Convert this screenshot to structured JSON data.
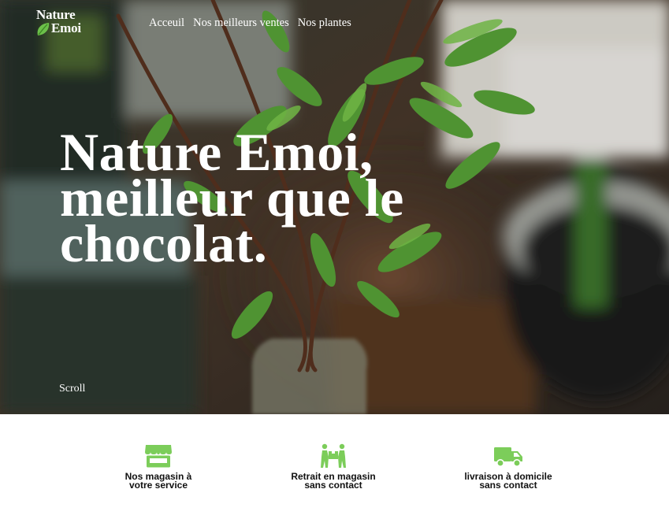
{
  "brand": {
    "name_line1": "Nature",
    "name_line2": "Emoi",
    "leaf_icon": "leaf-icon",
    "accent_color": "#6cc04a"
  },
  "nav": {
    "items": [
      {
        "label": "Acceuil"
      },
      {
        "label": "Nos meilleurs ventes"
      },
      {
        "label": "Nos plantes"
      }
    ]
  },
  "hero": {
    "headline_lines": [
      "Nature Emoi,",
      "meilleur que le",
      "chocolat."
    ],
    "scroll_label": "Scroll"
  },
  "services": [
    {
      "icon": "store-icon",
      "label": "Nos magasin à\nvotre service"
    },
    {
      "icon": "people-carrying-box-icon",
      "label": "Retrait en magasin\nsans contact"
    },
    {
      "icon": "delivery-truck-icon",
      "label": "livraison à domicile\nsans contact"
    }
  ],
  "colors": {
    "icon_green": "#7ccd5a",
    "hero_text": "#ffffff",
    "service_text": "#111111"
  }
}
